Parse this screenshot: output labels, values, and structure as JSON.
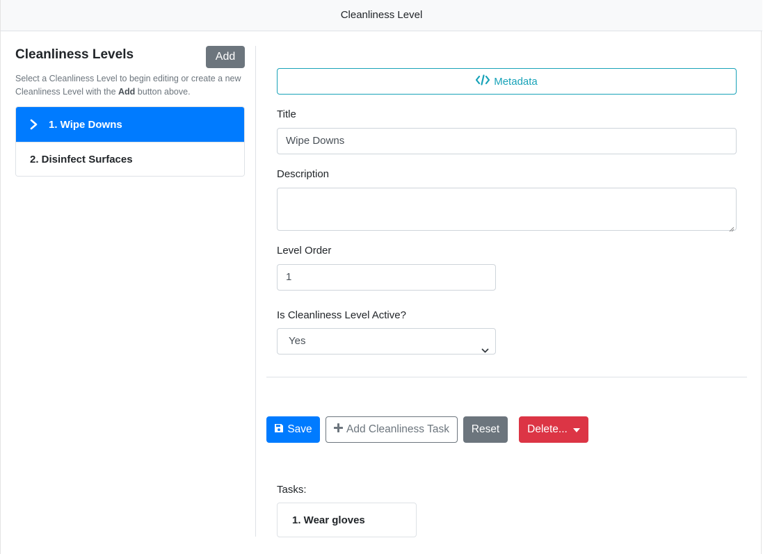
{
  "header": {
    "title": "Cleanliness Level"
  },
  "sidebar": {
    "title": "Cleanliness Levels",
    "add_label": "Add",
    "help_before": "Select a Cleanliness Level to begin editing or create a new Cleanliness Level with the ",
    "help_bold": "Add",
    "help_after": " button above.",
    "items": [
      {
        "label": "1. Wipe Downs",
        "active": true
      },
      {
        "label": "2. Disinfect Surfaces",
        "active": false
      }
    ]
  },
  "form": {
    "metadata_label": "Metadata",
    "title_label": "Title",
    "title_value": "Wipe Downs",
    "description_label": "Description",
    "description_value": "",
    "order_label": "Level Order",
    "order_value": "1",
    "active_label": "Is Cleanliness Level Active?",
    "active_value": "Yes"
  },
  "actions": {
    "save_label": "Save",
    "add_task_label": "Add Cleanliness Task",
    "reset_label": "Reset",
    "delete_label": "Delete..."
  },
  "tasks": {
    "label": "Tasks:",
    "items": [
      {
        "label": "1. Wear gloves"
      }
    ]
  },
  "colors": {
    "primary": "#007bff",
    "secondary": "#6c757d",
    "info": "#17a2b8",
    "danger": "#dc3545"
  },
  "icons": {
    "active_item": "chevron-right-icon",
    "metadata": "code-icon",
    "save": "floppy-disk-icon",
    "add_task": "plus-icon",
    "delete": "caret-down-icon",
    "select": "chevron-down-icon"
  }
}
